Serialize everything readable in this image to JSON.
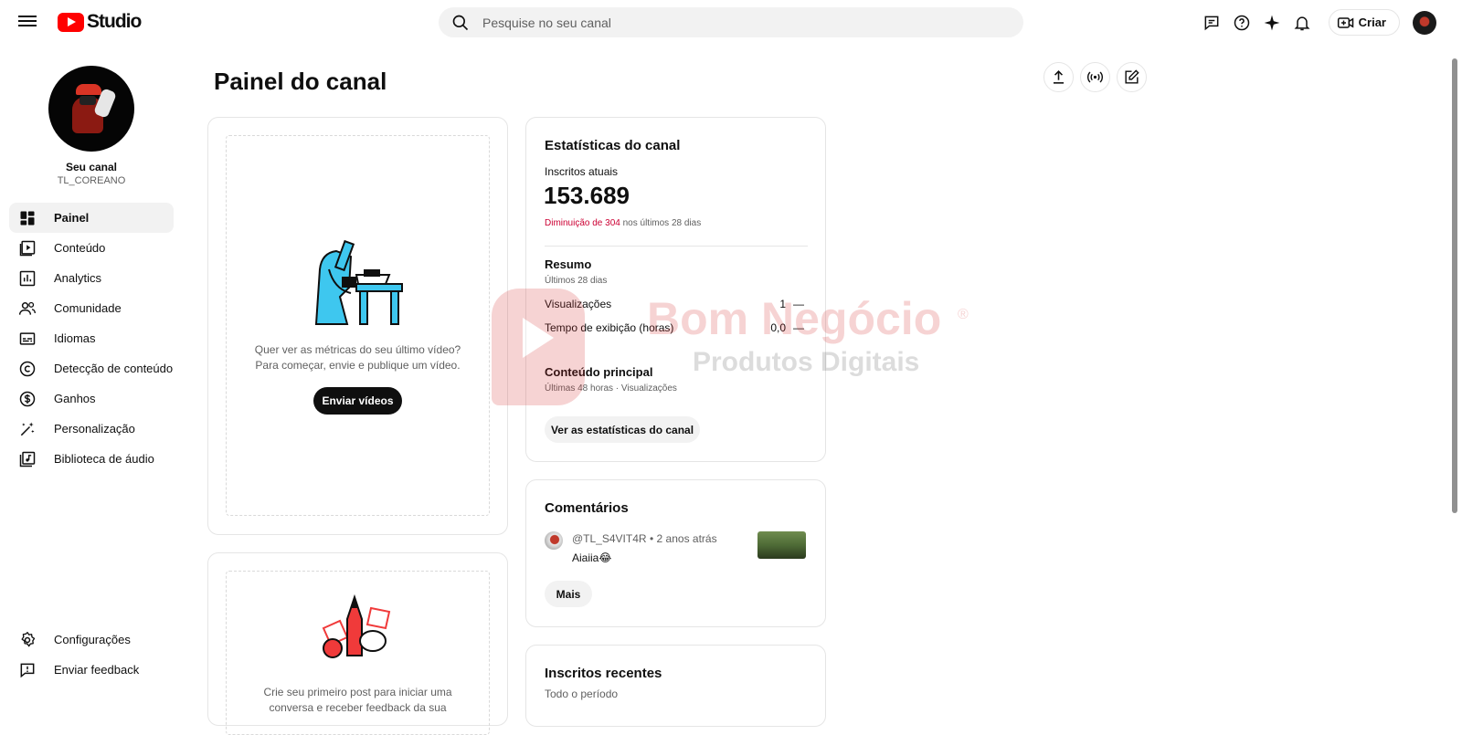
{
  "app": {
    "logo_text": "Studio",
    "brand_color": "#ff0000"
  },
  "search": {
    "placeholder": "Pesquise no seu canal"
  },
  "topbar": {
    "create_label": "Criar",
    "icons": [
      "subtitles-icon",
      "help-icon",
      "sparkle-icon",
      "bell-icon",
      "create-video-icon"
    ]
  },
  "channel": {
    "label": "Seu canal",
    "handle": "TL_COREANO"
  },
  "sidebar": {
    "items": [
      {
        "label": "Painel",
        "icon": "dashboard-icon",
        "active": true
      },
      {
        "label": "Conteúdo",
        "icon": "content-icon"
      },
      {
        "label": "Analytics",
        "icon": "analytics-icon"
      },
      {
        "label": "Comunidade",
        "icon": "community-icon"
      },
      {
        "label": "Idiomas",
        "icon": "subtitles-icon"
      },
      {
        "label": "Detecção de conteúdo",
        "icon": "copyright-icon"
      },
      {
        "label": "Ganhos",
        "icon": "dollar-icon"
      },
      {
        "label": "Personalização",
        "icon": "magic-wand-icon"
      },
      {
        "label": "Biblioteca de áudio",
        "icon": "audio-library-icon"
      }
    ],
    "bottom": [
      {
        "label": "Configurações",
        "icon": "gear-icon"
      },
      {
        "label": "Enviar feedback",
        "icon": "feedback-icon"
      }
    ]
  },
  "main": {
    "title": "Painel do canal",
    "upload_card": {
      "text_line1": "Quer ver as métricas do seu último vídeo?",
      "text_line2": "Para começar, envie e publique um vídeo.",
      "button": "Enviar vídeos"
    },
    "post_card": {
      "text_line1": "Crie seu primeiro post para iniciar uma",
      "text_line2": "conversa e receber feedback da sua"
    },
    "stats": {
      "title": "Estatísticas do canal",
      "subs_label": "Inscritos atuais",
      "subs_value": "153.689",
      "change_highlight": "Diminuição de 304",
      "change_rest": " nos últimos 28 dias",
      "summary_title": "Resumo",
      "summary_period": "Últimos 28 dias",
      "rows": [
        {
          "label": "Visualizações",
          "value": "1",
          "trend": "—"
        },
        {
          "label": "Tempo de exibição (horas)",
          "value": "0,0",
          "trend": "—"
        }
      ],
      "top_content_title": "Conteúdo principal",
      "top_content_period": "Últimas 48 horas · Visualizações",
      "button": "Ver as estatísticas do canal",
      "decrease_color": "#cc0033"
    },
    "comments": {
      "title": "Comentários",
      "author": "@TL_S4VIT4R",
      "time": "• 2 anos atrás",
      "text": "Aiaiia😂",
      "button": "Mais"
    },
    "recent_subs": {
      "title": "Inscritos recentes",
      "period": "Todo o período"
    }
  },
  "watermark": {
    "line1": "Bom Negócio",
    "line2": "Produtos Digitais",
    "mark": "®"
  }
}
